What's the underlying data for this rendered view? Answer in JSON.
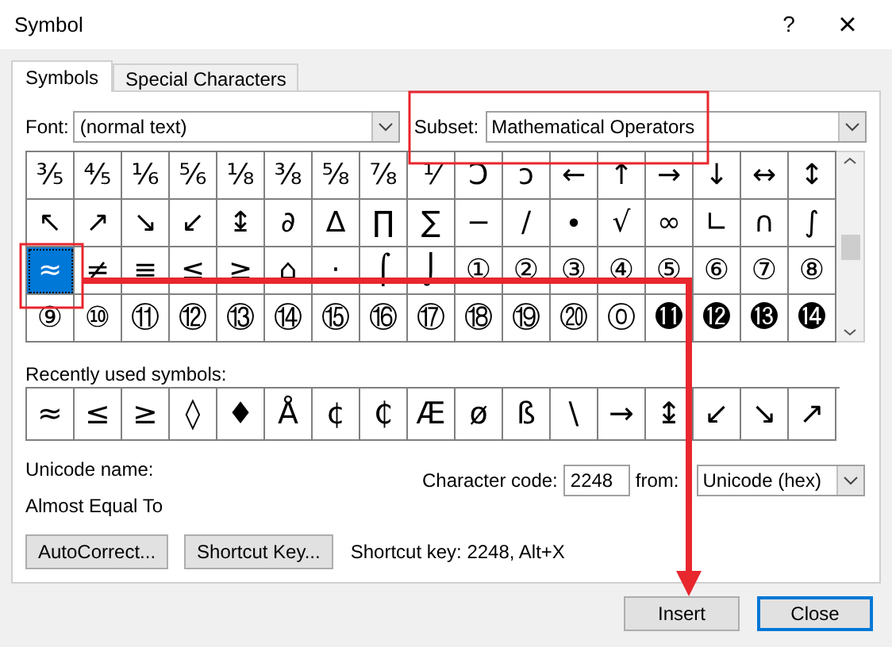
{
  "window": {
    "title": "Symbol",
    "help": "?",
    "close": "×"
  },
  "tabs": [
    {
      "label": "Symbols",
      "selected": true
    },
    {
      "label": "Special Characters",
      "selected": false
    }
  ],
  "font": {
    "label": "Font:",
    "value": "(normal text)"
  },
  "subset": {
    "label": "Subset:",
    "value": "Mathematical Operators"
  },
  "grid": {
    "rows": [
      [
        {
          "char": "⅗",
          "selected": false
        },
        {
          "char": "⅘",
          "selected": false
        },
        {
          "char": "⅙",
          "selected": false
        },
        {
          "char": "⅚",
          "selected": false
        },
        {
          "char": "⅛",
          "selected": false
        },
        {
          "char": "⅜",
          "selected": false
        },
        {
          "char": "⅝",
          "selected": false
        },
        {
          "char": "⅞",
          "selected": false
        },
        {
          "char": "⅟",
          "selected": false
        },
        {
          "char": "Ↄ",
          "selected": false
        },
        {
          "char": "ↄ",
          "selected": false
        },
        {
          "char": "←",
          "selected": false
        },
        {
          "char": "↑",
          "selected": false
        },
        {
          "char": "→",
          "selected": false
        },
        {
          "char": "↓",
          "selected": false
        },
        {
          "char": "↔",
          "selected": false
        },
        {
          "char": "↕",
          "selected": false
        }
      ],
      [
        {
          "char": "↖",
          "selected": false
        },
        {
          "char": "↗",
          "selected": false
        },
        {
          "char": "↘",
          "selected": false
        },
        {
          "char": "↙",
          "selected": false
        },
        {
          "char": "↨",
          "selected": false
        },
        {
          "char": "∂",
          "selected": false
        },
        {
          "char": "∆",
          "selected": false
        },
        {
          "char": "∏",
          "selected": false
        },
        {
          "char": "∑",
          "selected": false
        },
        {
          "char": "−",
          "selected": false
        },
        {
          "char": "∕",
          "selected": false
        },
        {
          "char": "∙",
          "selected": false
        },
        {
          "char": "√",
          "selected": false
        },
        {
          "char": "∞",
          "selected": false
        },
        {
          "char": "∟",
          "selected": false
        },
        {
          "char": "∩",
          "selected": false
        },
        {
          "char": "∫",
          "selected": false
        }
      ],
      [
        {
          "char": "≈",
          "selected": true
        },
        {
          "char": "≠",
          "selected": false
        },
        {
          "char": "≡",
          "selected": false
        },
        {
          "char": "≤",
          "selected": false
        },
        {
          "char": "≥",
          "selected": false
        },
        {
          "char": "⌂",
          "selected": false
        },
        {
          "char": "·",
          "selected": false
        },
        {
          "char": "⌠",
          "selected": false
        },
        {
          "char": "⌡",
          "selected": false
        },
        {
          "char": "①",
          "selected": false
        },
        {
          "char": "②",
          "selected": false
        },
        {
          "char": "③",
          "selected": false
        },
        {
          "char": "④",
          "selected": false
        },
        {
          "char": "⑤",
          "selected": false
        },
        {
          "char": "⑥",
          "selected": false
        },
        {
          "char": "⑦",
          "selected": false
        },
        {
          "char": "⑧",
          "selected": false
        }
      ],
      [
        {
          "char": "⑨",
          "selected": false
        },
        {
          "char": "⑩",
          "selected": false
        },
        {
          "char": "⑪",
          "selected": false
        },
        {
          "char": "⑫",
          "selected": false
        },
        {
          "char": "⑬",
          "selected": false
        },
        {
          "char": "⑭",
          "selected": false
        },
        {
          "char": "⑮",
          "selected": false
        },
        {
          "char": "⑯",
          "selected": false
        },
        {
          "char": "⑰",
          "selected": false
        },
        {
          "char": "⑱",
          "selected": false
        },
        {
          "char": "⑲",
          "selected": false
        },
        {
          "char": "⑳",
          "selected": false
        },
        {
          "char": "⓪",
          "selected": false
        },
        {
          "char": "⓫",
          "selected": false
        },
        {
          "char": "⓬",
          "selected": false
        },
        {
          "char": "⓭",
          "selected": false
        },
        {
          "char": "⓮",
          "selected": false
        }
      ]
    ]
  },
  "recent": {
    "label": "Recently used symbols:",
    "symbols": [
      "≈",
      "≤",
      "≥",
      "◊",
      "♦",
      "Å",
      "¢",
      "₵",
      "Æ",
      "ø",
      "ß",
      "\\",
      "→",
      "↨",
      "↙",
      "↘",
      "↗"
    ]
  },
  "unicode_name": {
    "label": "Unicode name:",
    "value": "Almost Equal To"
  },
  "character_code": {
    "label": "Character code:",
    "value": "2248"
  },
  "from": {
    "label": "from:",
    "value": "Unicode (hex)"
  },
  "buttons": [
    {
      "label": "AutoCorrect..."
    },
    {
      "label": "Shortcut Key..."
    }
  ],
  "shortcut_text": "Shortcut key: 2248, Alt+X",
  "footer_buttons": [
    {
      "label": "Insert",
      "default": false
    },
    {
      "label": "Close",
      "default": true
    }
  ]
}
